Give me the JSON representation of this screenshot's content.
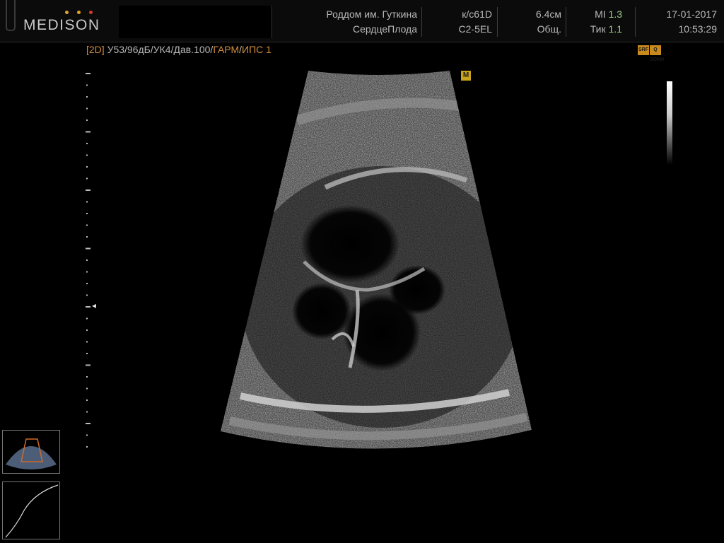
{
  "header": {
    "logo_text": "MEDISON",
    "logo_dot_colors": [
      "#e0a22c",
      "#e0a22c",
      "#d63a2a"
    ],
    "hospital": "Роддом им. Гуткина",
    "preset": "СердцеПлода",
    "probe_model": "к/с61D",
    "probe_type": "C2-5EL",
    "depth": "6.4см",
    "mode": "Общ.",
    "mi_label": "MI",
    "mi_value": "1.3",
    "tic_label": "Тик",
    "tic_value": "1.1",
    "date": "17-01-2017",
    "time": "10:53:29"
  },
  "params": {
    "mode_tag": "[2D]",
    "values": "У53/96дБ/УК4/Дав.100/",
    "harmonic": "ГАРМ",
    "sep": "/",
    "ips": "ИПС 1"
  },
  "badges": {
    "srf": "SRF",
    "sonh": "Q SONH",
    "m": "M"
  },
  "colors": {
    "accent_orange": "#d08a3a",
    "mi_green": "#9acd86",
    "badge_amber": "#c98a1c"
  },
  "icons": {
    "probe_sector": "sector-probe-icon",
    "gamma_curve": "gamma-curve-icon",
    "focus": "focus-marker-icon"
  }
}
